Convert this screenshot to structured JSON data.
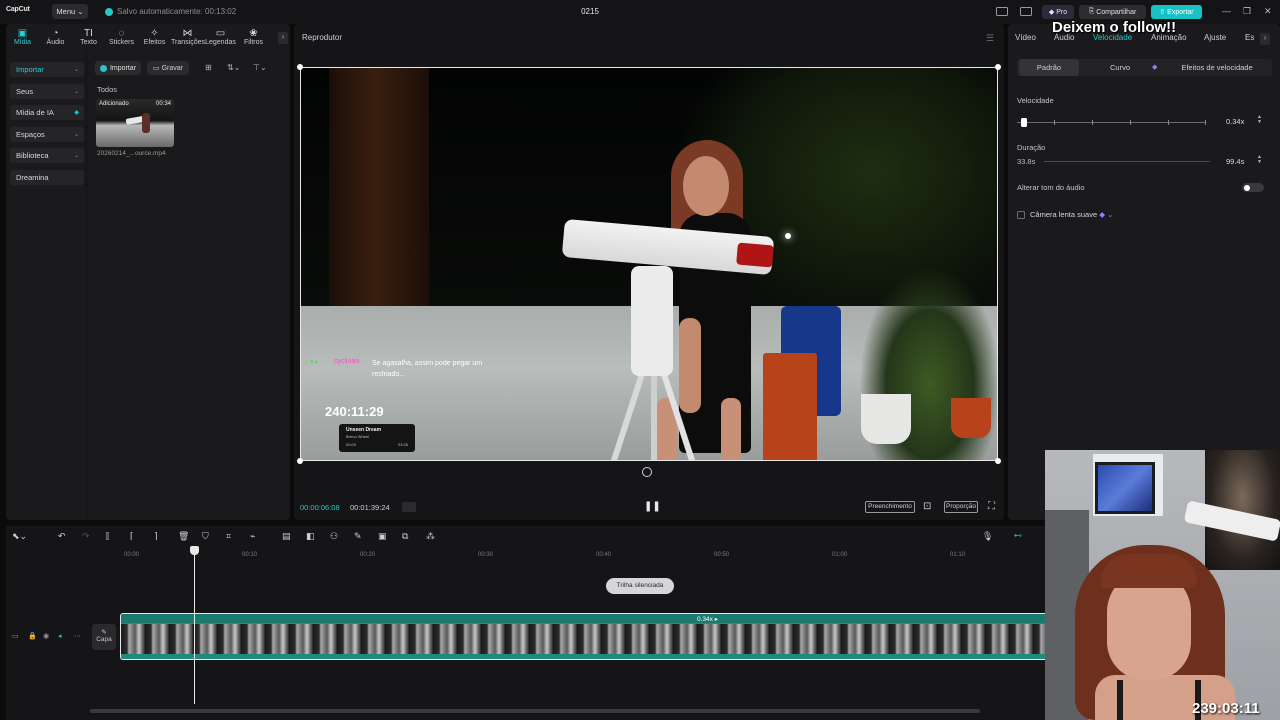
{
  "titlebar": {
    "logo": "CapCut",
    "menu": "Menu",
    "autosave": "Salvo automaticamente: 00:13:02",
    "project": "0215",
    "pro": "Pro",
    "share": "Compartilhar",
    "export": "Exportar",
    "minimize": "—",
    "maximize": "❐",
    "close": "✕"
  },
  "tools": [
    {
      "label": "Mídia",
      "icon": "▣"
    },
    {
      "label": "Áudio",
      "icon": "◔"
    },
    {
      "label": "Texto",
      "icon": "TI"
    },
    {
      "label": "Stickers",
      "icon": "◌"
    },
    {
      "label": "Efeitos",
      "icon": "✧"
    },
    {
      "label": "Transições",
      "icon": "⋈"
    },
    {
      "label": "Legendas",
      "icon": "▭"
    },
    {
      "label": "Filtros",
      "icon": "❀"
    }
  ],
  "sidenav": [
    {
      "label": "Importar"
    },
    {
      "label": "Seus"
    },
    {
      "label": "Mídia de IA"
    },
    {
      "label": "Espaços"
    },
    {
      "label": "Biblioteca"
    },
    {
      "label": "Dreamina"
    }
  ],
  "media": {
    "import": "Importar",
    "record": "Gravar",
    "all": "Todos",
    "thumb_added": "Adicionado",
    "thumb_duration": "00:34",
    "thumb_name": "20260214_...ource.mp4"
  },
  "player": {
    "title": "Reprodutor",
    "current_time": "00:00:06:08",
    "total_time": "00:01:39:24",
    "fill": "Preenchimento",
    "ratio": "Proporção",
    "chat_user": "cyclinaa",
    "chat_msg": "Se agasalha, assim pode pegar um resfriado...",
    "stream_timer": "240:11:29",
    "music_title": "Unseen Dream",
    "music_artist": "Breno Wheel",
    "music_start": "00:00",
    "music_end": "03:26"
  },
  "right": {
    "tabs": [
      "Vídeo",
      "Áudio",
      "Velocidade",
      "Animação",
      "Ajuste",
      "Es"
    ],
    "speed_tabs": [
      "Padrão",
      "Curvo",
      "Efeitos de velocidade"
    ],
    "speed_label": "Velocidade",
    "speed_value": "0.34x",
    "speed_level": 0.02,
    "duration_label": "Duração",
    "duration_from": "33.8s",
    "duration_to": "99.4s",
    "pitch_label": "Alterar tom do áudio",
    "pitch_on": false,
    "slowmo_label": "Câmera lenta suave",
    "overlay": "Deixem o follow!!",
    "accent": "#29c6c6"
  },
  "timeline": {
    "ruler": [
      "00:00",
      "00:10",
      "00:20",
      "00:30",
      "00:40",
      "00:50",
      "01:00",
      "01:10"
    ],
    "muted_track": "Trilha silenciada",
    "cover": "Capa",
    "clip_speed": "0.34x ▸"
  },
  "webcam": {
    "timer": "239:03:11"
  }
}
